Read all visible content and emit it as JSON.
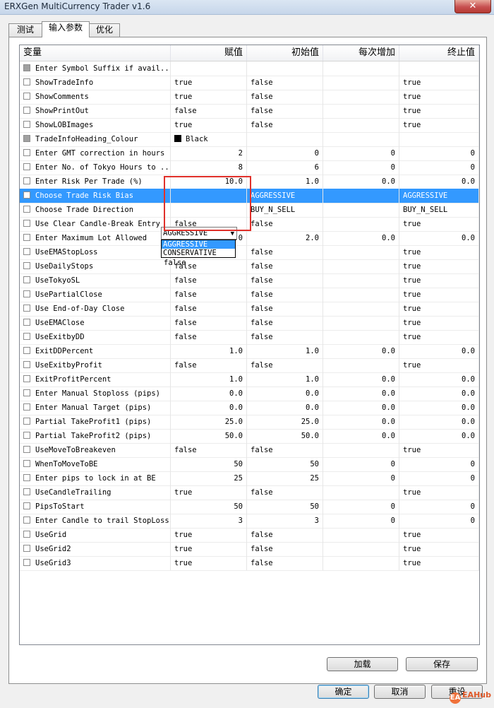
{
  "window": {
    "title": "ERXGen MultiCurrency Trader v1.6",
    "close_glyph": "✕"
  },
  "tabs": [
    {
      "label": "测试"
    },
    {
      "label": "输入参数"
    },
    {
      "label": "优化"
    }
  ],
  "columns": [
    "变量",
    "赋值",
    "初始值",
    "每次增加",
    "终止值"
  ],
  "rows": [
    {
      "name": "Enter Symbol Suffix if avail...",
      "value": "",
      "start": "",
      "step": "",
      "stop": "",
      "num": false,
      "disabled": true
    },
    {
      "name": "ShowTradeInfo",
      "value": "true",
      "start": "false",
      "step": "",
      "stop": "true",
      "num": false
    },
    {
      "name": "ShowComments",
      "value": "true",
      "start": "false",
      "step": "",
      "stop": "true",
      "num": false
    },
    {
      "name": "ShowPrintOut",
      "value": "false",
      "start": "false",
      "step": "",
      "stop": "true",
      "num": false
    },
    {
      "name": "ShowLOBImages",
      "value": "true",
      "start": "false",
      "step": "",
      "stop": "true",
      "num": false
    },
    {
      "name": "TradeInfoHeading_Colour",
      "value": "Black",
      "start": "",
      "step": "",
      "stop": "",
      "num": false,
      "disabled": true,
      "swatch": true
    },
    {
      "name": "Enter GMT correction in hours",
      "value": "2",
      "start": "0",
      "step": "0",
      "stop": "0",
      "num": true
    },
    {
      "name": "Enter No. of Tokyo Hours to ...",
      "value": "8",
      "start": "6",
      "step": "0",
      "stop": "0",
      "num": true
    },
    {
      "name": "Enter Risk Per Trade (%)",
      "value": "10.0",
      "start": "1.0",
      "step": "0.0",
      "stop": "0.0",
      "num": true
    },
    {
      "name": "Choose Trade Risk Bias",
      "value": "",
      "start": "AGGRESSIVE",
      "step": "",
      "stop": "AGGRESSIVE",
      "num": false,
      "selected": true
    },
    {
      "name": "Choose Trade Direction",
      "value": "",
      "start": "BUY_N_SELL",
      "step": "",
      "stop": "BUY_N_SELL",
      "num": false
    },
    {
      "name": "Use Clear Candle-Break Entry",
      "value": "false",
      "start": "false",
      "step": "",
      "stop": "true",
      "num": false
    },
    {
      "name": "Enter Maximum Lot Allowed",
      "value": "2.0",
      "start": "2.0",
      "step": "0.0",
      "stop": "0.0",
      "num": true
    },
    {
      "name": "UseEMAStopLoss",
      "value": "false",
      "start": "false",
      "step": "",
      "stop": "true",
      "num": false
    },
    {
      "name": "UseDailyStops",
      "value": "false",
      "start": "false",
      "step": "",
      "stop": "true",
      "num": false
    },
    {
      "name": "UseTokyoSL",
      "value": "false",
      "start": "false",
      "step": "",
      "stop": "true",
      "num": false
    },
    {
      "name": "UsePartialClose",
      "value": "false",
      "start": "false",
      "step": "",
      "stop": "true",
      "num": false
    },
    {
      "name": "Use End-of-Day Close",
      "value": "false",
      "start": "false",
      "step": "",
      "stop": "true",
      "num": false
    },
    {
      "name": "UseEMAClose",
      "value": "false",
      "start": "false",
      "step": "",
      "stop": "true",
      "num": false
    },
    {
      "name": "UseExitbyDD",
      "value": "false",
      "start": "false",
      "step": "",
      "stop": "true",
      "num": false
    },
    {
      "name": "ExitDDPercent",
      "value": "1.0",
      "start": "1.0",
      "step": "0.0",
      "stop": "0.0",
      "num": true
    },
    {
      "name": "UseExitbyProfit",
      "value": "false",
      "start": "false",
      "step": "",
      "stop": "true",
      "num": false
    },
    {
      "name": "ExitProfitPercent",
      "value": "1.0",
      "start": "1.0",
      "step": "0.0",
      "stop": "0.0",
      "num": true
    },
    {
      "name": "Enter Manual Stoploss (pips)",
      "value": "0.0",
      "start": "0.0",
      "step": "0.0",
      "stop": "0.0",
      "num": true
    },
    {
      "name": "Enter Manual Target (pips)",
      "value": "0.0",
      "start": "0.0",
      "step": "0.0",
      "stop": "0.0",
      "num": true
    },
    {
      "name": "Partial TakeProfit1 (pips)",
      "value": "25.0",
      "start": "25.0",
      "step": "0.0",
      "stop": "0.0",
      "num": true
    },
    {
      "name": "Partial TakeProfit2 (pips)",
      "value": "50.0",
      "start": "50.0",
      "step": "0.0",
      "stop": "0.0",
      "num": true
    },
    {
      "name": "UseMoveToBreakeven",
      "value": "false",
      "start": "false",
      "step": "",
      "stop": "true",
      "num": false
    },
    {
      "name": "WhenToMoveToBE",
      "value": "50",
      "start": "50",
      "step": "0",
      "stop": "0",
      "num": true
    },
    {
      "name": "Enter pips to lock in at BE",
      "value": "25",
      "start": "25",
      "step": "0",
      "stop": "0",
      "num": true
    },
    {
      "name": "UseCandleTrailing",
      "value": "true",
      "start": "false",
      "step": "",
      "stop": "true",
      "num": false
    },
    {
      "name": "PipsToStart",
      "value": "50",
      "start": "50",
      "step": "0",
      "stop": "0",
      "num": true
    },
    {
      "name": "Enter Candle to trail StopLoss",
      "value": "3",
      "start": "3",
      "step": "0",
      "stop": "0",
      "num": true
    },
    {
      "name": "UseGrid",
      "value": "true",
      "start": "false",
      "step": "",
      "stop": "true",
      "num": false
    },
    {
      "name": "UseGrid2",
      "value": "true",
      "start": "false",
      "step": "",
      "stop": "true",
      "num": false
    },
    {
      "name": "UseGrid3",
      "value": "true",
      "start": "false",
      "step": "",
      "stop": "true",
      "num": false
    }
  ],
  "dropdown": {
    "current": "AGGRESSIVE",
    "options": [
      "AGGRESSIVE",
      "CONSERVATIVE"
    ],
    "overlay_value": "false"
  },
  "buttons": {
    "load": "加载",
    "save": "保存",
    "ok": "确定",
    "cancel": "取消",
    "reset": "重设"
  },
  "watermark": {
    "text": "EAHub",
    "logo": "EA"
  }
}
